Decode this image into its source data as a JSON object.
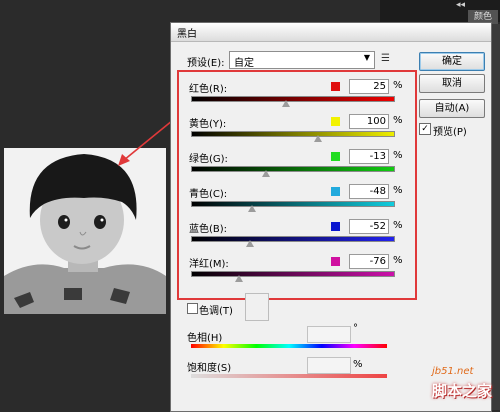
{
  "workspace": {
    "chevron": "◂◂",
    "side_tab": "颜色"
  },
  "dialog": {
    "title": "黑白",
    "preset_label": "预设(E):",
    "preset_value": "自定",
    "buttons": {
      "ok": "确定",
      "cancel": "取消",
      "auto": "自动(A)"
    },
    "preview_label": "预览(P)",
    "preview_checked": "✓",
    "channels": [
      {
        "label": "红色(R):",
        "value": "25",
        "unit": "%",
        "color": "#e01010",
        "slider_fraction": 0.47,
        "bar_gradient": "linear-gradient(to right,#000,#e00)"
      },
      {
        "label": "黄色(Y):",
        "value": "100",
        "unit": "%",
        "color": "#f2f200",
        "slider_fraction": 0.63,
        "bar_gradient": "linear-gradient(to right,#000,#ee0)"
      },
      {
        "label": "绿色(G):",
        "value": "-13",
        "unit": "%",
        "color": "#22dd22",
        "slider_fraction": 0.37,
        "bar_gradient": "linear-gradient(to right,#000,#1c1)"
      },
      {
        "label": "青色(C):",
        "value": "-48",
        "unit": "%",
        "color": "#22aadd",
        "slider_fraction": 0.3,
        "bar_gradient": "linear-gradient(to right,#000,#1cd)"
      },
      {
        "label": "蓝色(B):",
        "value": "-52",
        "unit": "%",
        "color": "#0a16d0",
        "slider_fraction": 0.29,
        "bar_gradient": "linear-gradient(to right,#000,#22e)"
      },
      {
        "label": "洋红(M):",
        "value": "-76",
        "unit": "%",
        "color": "#d010a0",
        "slider_fraction": 0.24,
        "bar_gradient": "linear-gradient(to right,#000,#c1a)"
      }
    ],
    "tint_label": "色调(T)",
    "hue_label": "色相(H)",
    "hue_unit": "°",
    "saturation_label": "饱和度(S)",
    "saturation_unit": "%"
  },
  "watermark": {
    "url": "jb51.net",
    "text": "脚本之家"
  },
  "colors": {
    "highlight_box": "#e0393a",
    "arrow": "#e0393a"
  }
}
